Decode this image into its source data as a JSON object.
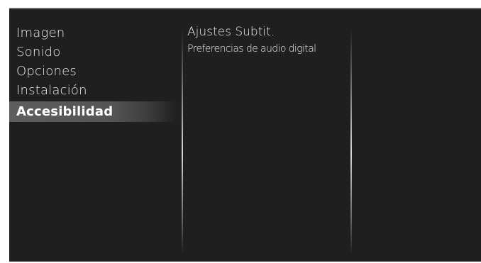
{
  "menu": {
    "items": [
      {
        "label": "Imagen"
      },
      {
        "label": "Sonido"
      },
      {
        "label": "Opciones"
      },
      {
        "label": "Instalación"
      },
      {
        "label": "Accesibilidad",
        "selected": true
      }
    ]
  },
  "submenu": {
    "items": [
      {
        "label": "Ajustes Subtit."
      },
      {
        "label": "Preferencias de audio digital"
      }
    ]
  },
  "colors": {
    "screen_background": "#201f1f",
    "highlight": "#5e5e5e",
    "text": "#e9e9e9"
  }
}
